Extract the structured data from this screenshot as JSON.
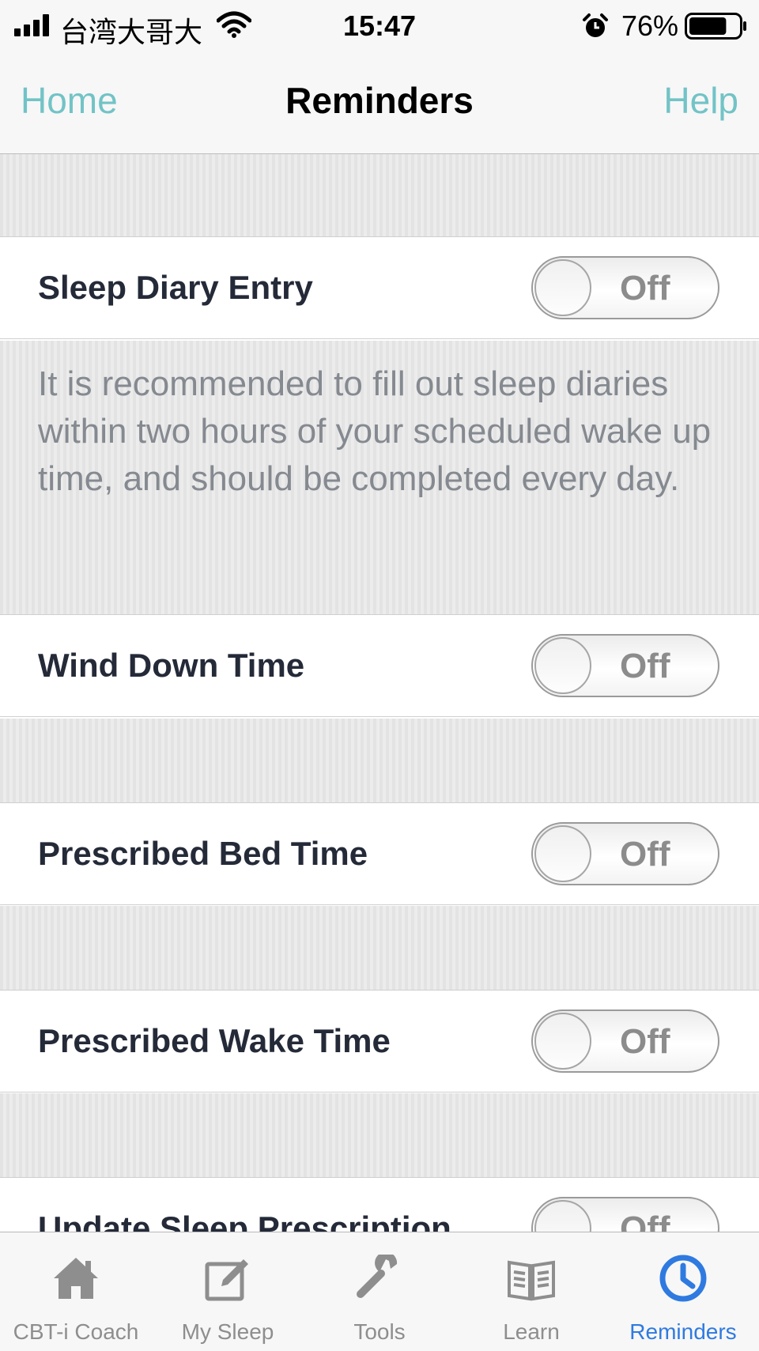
{
  "status_bar": {
    "carrier": "台湾大哥大",
    "time": "15:47",
    "battery_percent": "76%",
    "battery_level": 0.76,
    "icons": [
      "signal-icon",
      "wifi-icon",
      "alarm-icon",
      "battery-icon"
    ]
  },
  "nav": {
    "left_button": "Home",
    "title": "Reminders",
    "right_button": "Help",
    "accent_color": "#72c3c6"
  },
  "reminders": [
    {
      "label": "Sleep Diary Entry",
      "state": "Off"
    },
    {
      "label": "Wind Down Time",
      "state": "Off"
    },
    {
      "label": "Prescribed Bed Time",
      "state": "Off"
    },
    {
      "label": "Prescribed Wake Time",
      "state": "Off"
    },
    {
      "label": "Update Sleep Prescription",
      "state": "Off"
    }
  ],
  "sleep_diary_note": "It is recommended to fill out sleep diaries within two hours of your scheduled wake up time, and should be completed every day.",
  "tabs": [
    {
      "label": "CBT-i Coach",
      "icon": "home-icon"
    },
    {
      "label": "My Sleep",
      "icon": "edit-icon"
    },
    {
      "label": "Tools",
      "icon": "wrench-icon"
    },
    {
      "label": "Learn",
      "icon": "book-icon"
    },
    {
      "label": "Reminders",
      "icon": "clock-icon",
      "active": true
    }
  ],
  "active_tab_color": "#2f7ae0"
}
